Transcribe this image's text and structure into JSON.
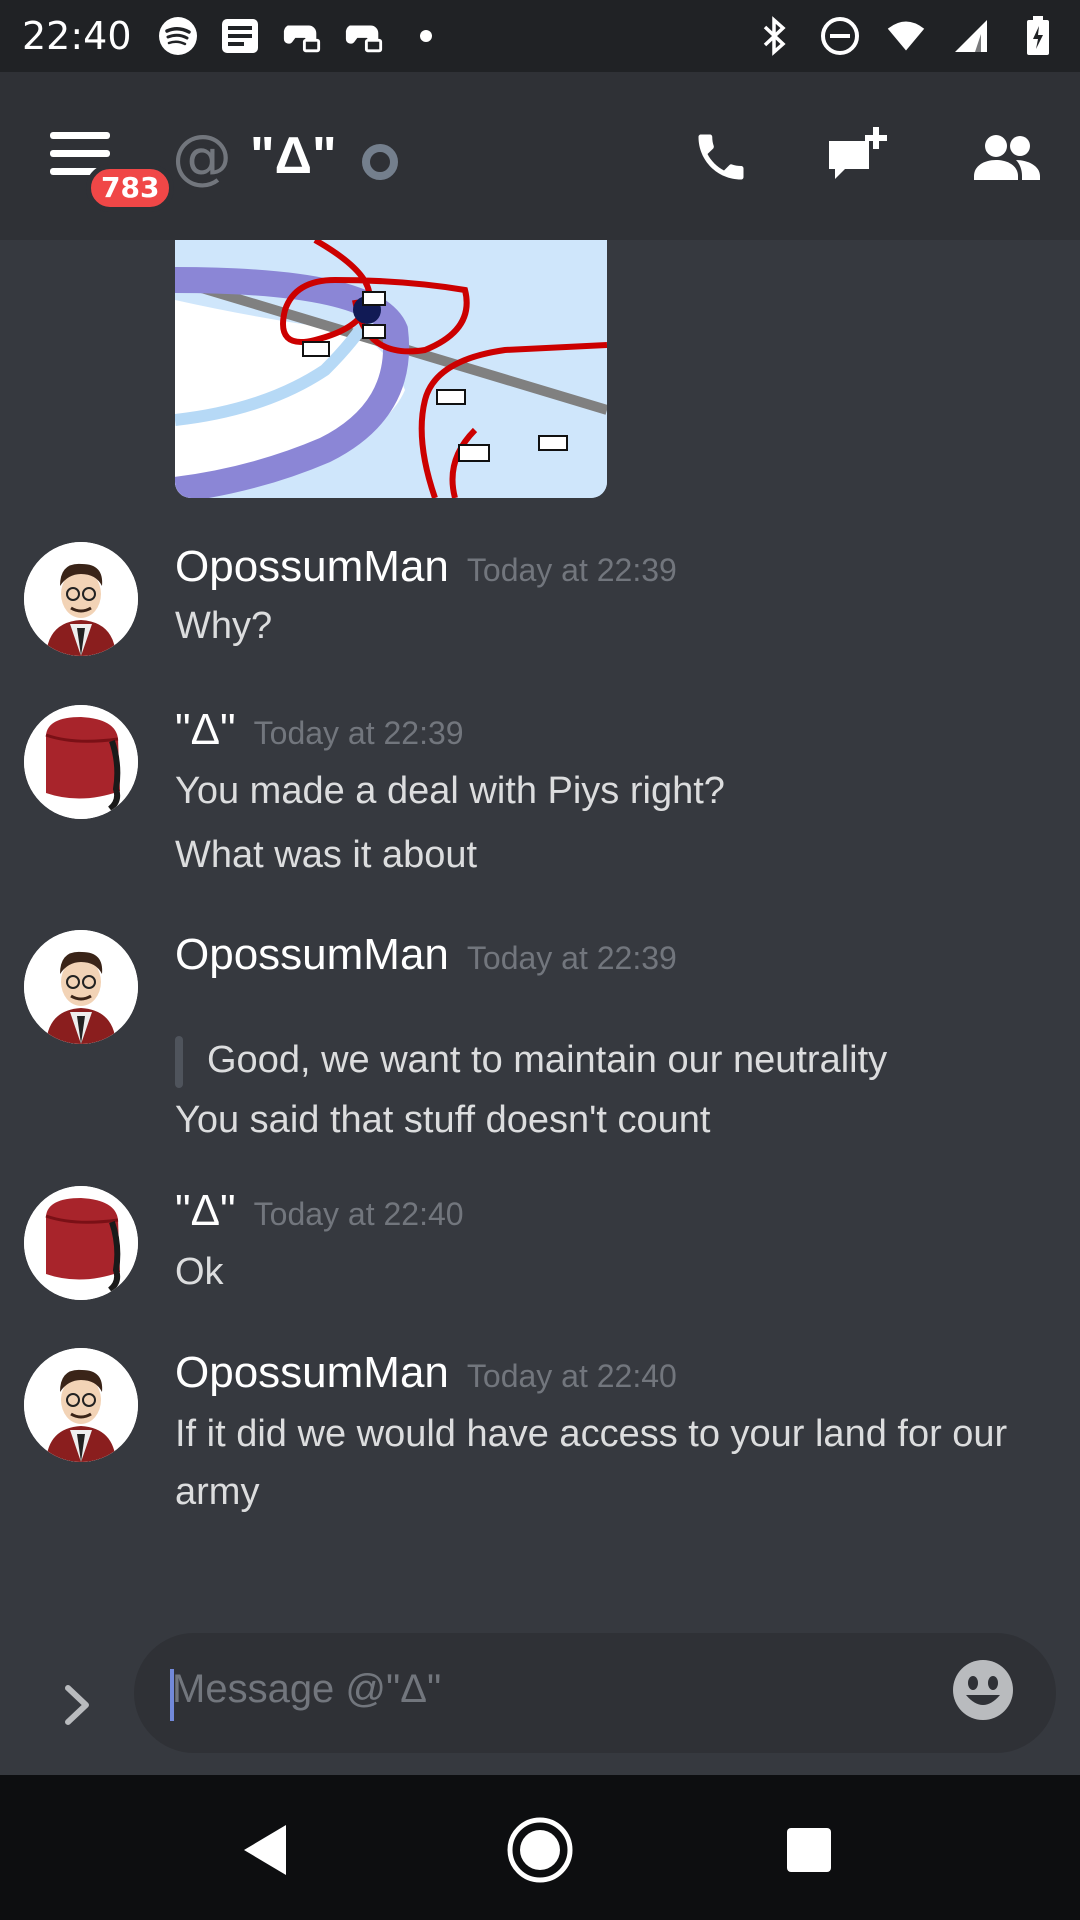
{
  "status_bar": {
    "time": "22:40",
    "left_icons": [
      "spotify-icon",
      "news-icon",
      "game-controller-icon",
      "game-controller-icon",
      "dot-icon"
    ],
    "right_icons": [
      "bluetooth-icon",
      "do-not-disturb-icon",
      "wifi-icon",
      "signal-icon",
      "battery-icon"
    ]
  },
  "header": {
    "badge_count": "783",
    "at_symbol": "@",
    "channel_name": "\"Δ\"",
    "actions": [
      "call-icon",
      "new-message-icon",
      "members-icon"
    ]
  },
  "messages": [
    {
      "author": "OpossumMan",
      "timestamp": "Today at 22:39",
      "lines": [
        "Why?"
      ],
      "avatar": "opossum-avatar"
    },
    {
      "author": "\"Δ\"",
      "timestamp": "Today at 22:39",
      "lines": [
        "You made a deal with Piys right?",
        "What was it about"
      ],
      "avatar": "fez-avatar"
    },
    {
      "author": "OpossumMan",
      "timestamp": "Today at 22:39",
      "quote": "Good, we want to maintain our neutrality",
      "lines": [
        "You said that stuff doesn't count"
      ],
      "avatar": "opossum-avatar"
    },
    {
      "author": "\"Δ\"",
      "timestamp": "Today at 22:40",
      "lines": [
        "Ok"
      ],
      "avatar": "fez-avatar"
    },
    {
      "author": "OpossumMan",
      "timestamp": "Today at 22:40",
      "lines": [
        "If it did we would have access to your land for our",
        "army"
      ],
      "avatar": "opossum-avatar"
    }
  ],
  "composer": {
    "placeholder": "Message @\"Δ\""
  },
  "colors": {
    "background": "#36393f",
    "header": "#2f3136",
    "badge": "#f04747",
    "accent": "#7289da"
  }
}
